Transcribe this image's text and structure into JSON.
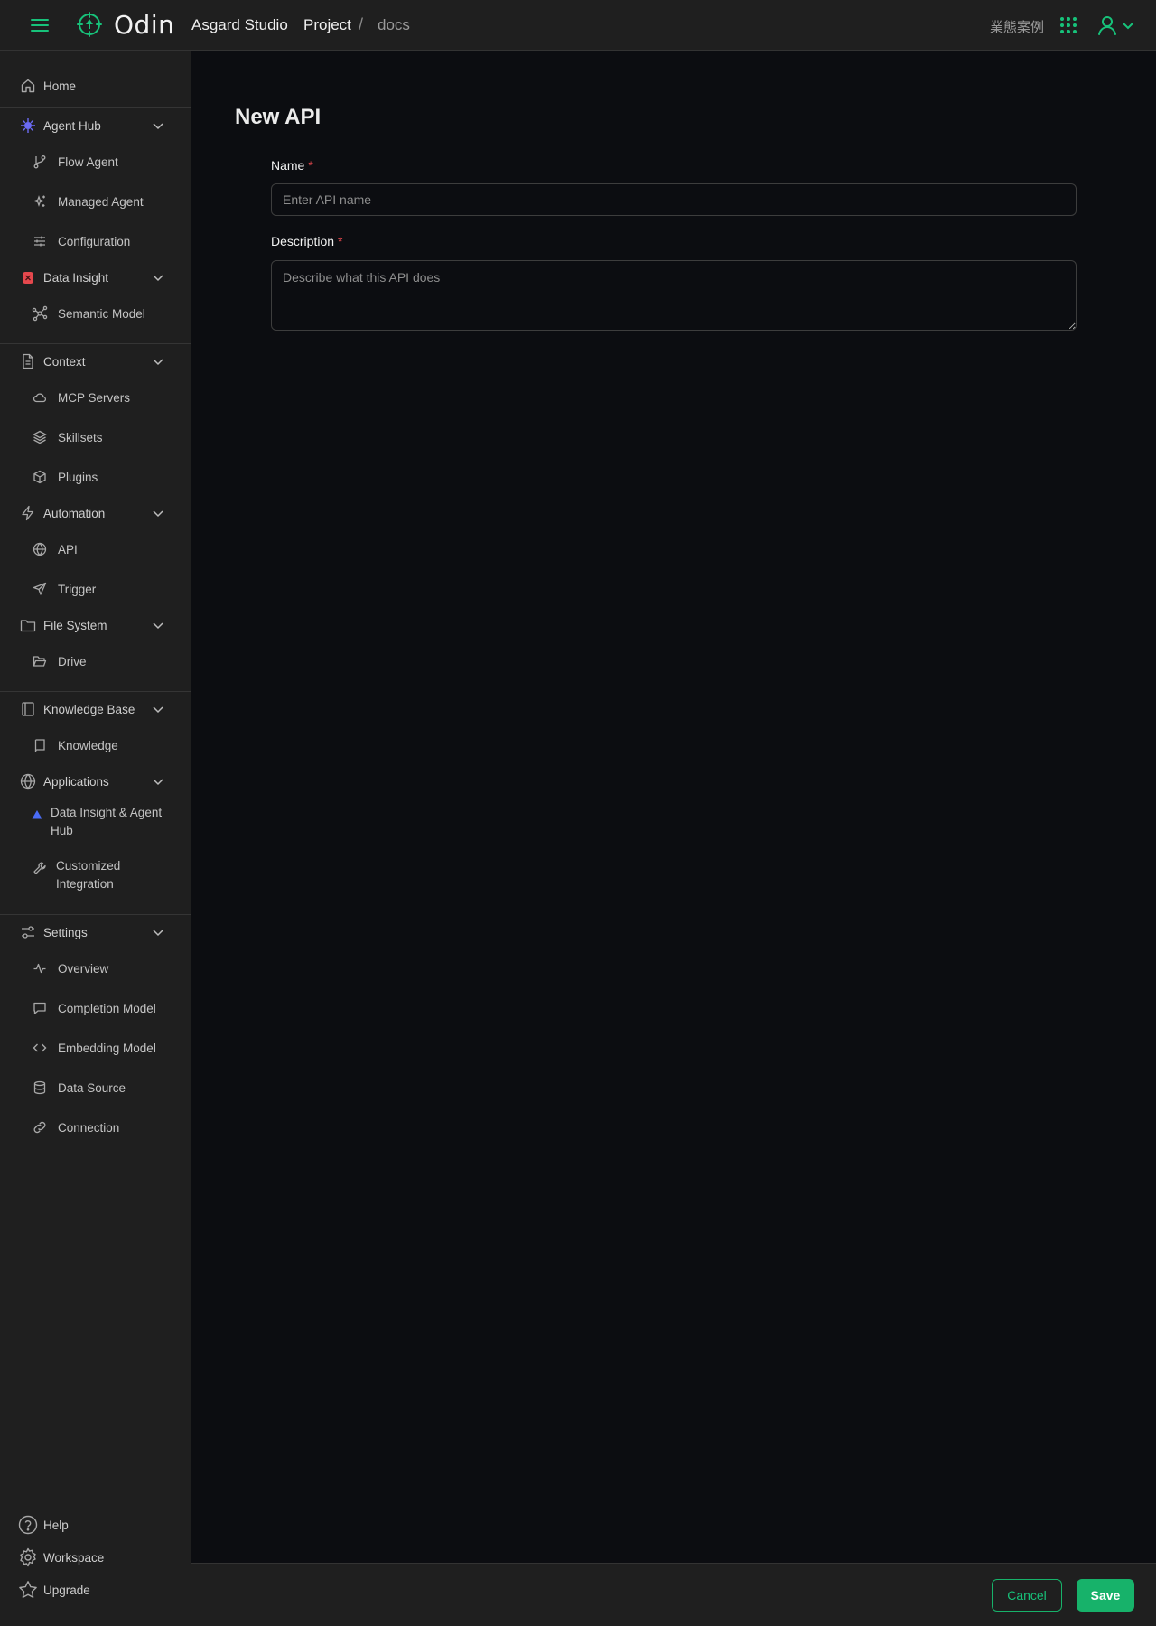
{
  "header": {
    "brand": "Odin",
    "org": "Asgard Studio",
    "breadcrumb": {
      "project": "Project",
      "separator": "/",
      "current": "docs"
    },
    "top_link": "業態案例",
    "icons": {
      "menu": "hamburger-menu-icon",
      "logo": "odin-logo-icon",
      "apps": "apps-grid-icon",
      "user": "user-icon",
      "user_menu": "chevron-down-icon"
    }
  },
  "sidebar": {
    "home": "Home",
    "agent_hub": {
      "label": "Agent Hub",
      "items": [
        "Flow Agent",
        "Managed Agent",
        "Configuration"
      ]
    },
    "data_insight": {
      "label": "Data Insight",
      "items": [
        "Semantic Model"
      ]
    },
    "context": {
      "label": "Context",
      "items": [
        "MCP Servers",
        "Skillsets",
        "Plugins"
      ]
    },
    "automation": {
      "label": "Automation",
      "items": [
        "API",
        "Trigger"
      ]
    },
    "file_system": {
      "label": "File System",
      "items": [
        "Drive"
      ]
    },
    "knowledge_base": {
      "label": "Knowledge Base",
      "items": [
        "Knowledge"
      ]
    },
    "applications": {
      "label": "Applications",
      "items": [
        "Data Insight & Agent Hub",
        "Customized Integration"
      ]
    },
    "settings": {
      "label": "Settings",
      "items": [
        "Overview",
        "Completion Model",
        "Embedding Model",
        "Data Source",
        "Connection"
      ]
    },
    "bottom": {
      "help": "Help",
      "workspace": "Workspace",
      "upgrade": "Upgrade"
    }
  },
  "form": {
    "title": "New API",
    "name_label": "Name",
    "name_placeholder": "Enter API name",
    "name_value": "",
    "description_label": "Description",
    "description_placeholder": "Describe what this API does",
    "description_value": "",
    "required_mark": "*"
  },
  "footer": {
    "cancel": "Cancel",
    "save": "Save"
  },
  "colors": {
    "accent": "#17b26a",
    "required": "#e5484d",
    "agent_hub_icon": "#6b6bf5",
    "data_insight_icon": "#e5484d"
  }
}
